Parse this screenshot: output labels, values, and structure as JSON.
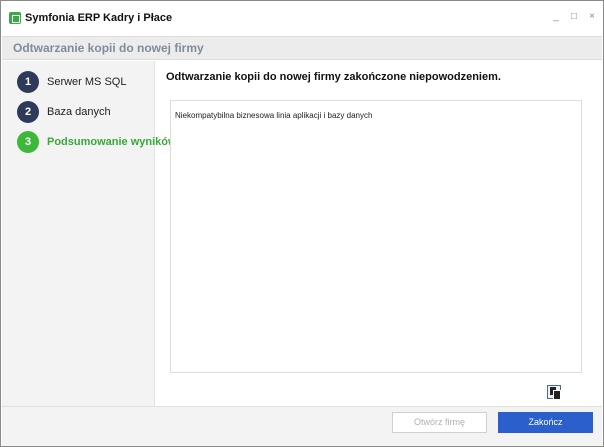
{
  "window": {
    "title": "Symfonia ERP Kadry i Płace",
    "controls": [
      "_",
      "□",
      "×"
    ]
  },
  "header": {
    "title": "Odtwarzanie kopii do nowej firmy"
  },
  "steps": [
    {
      "number": "1",
      "label": "Serwer MS SQL",
      "active": false
    },
    {
      "number": "2",
      "label": "Baza danych",
      "active": false
    },
    {
      "number": "3",
      "label": "Podsumowanie wyników",
      "active": true
    }
  ],
  "main": {
    "heading": "Odtwarzanie kopii do nowej firmy zakończone niepowodzeniem.",
    "result_text": "Niekompatybilna biznesowa linia aplikacji i bazy danych"
  },
  "footer": {
    "open_company_label": "Otwórz firmę",
    "finish_label": "Zakończ"
  },
  "colors": {
    "step_default": "#2d3a5a",
    "step_active": "#3db83a",
    "primary_button": "#2b5fcc"
  },
  "icons": {
    "copy": "copy-icon"
  }
}
